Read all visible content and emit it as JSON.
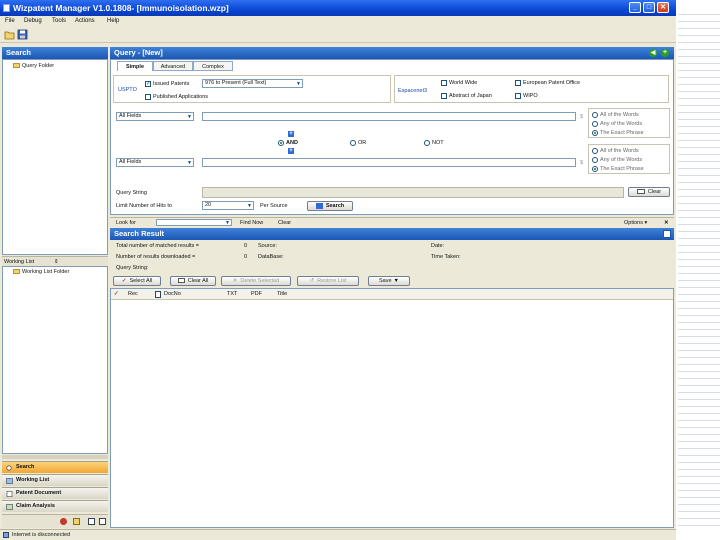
{
  "window": {
    "title": "Wizpatent Manager V1.0.1808- [Immunoisolation.wzp]",
    "minimize_glyph": "_",
    "maximize_glyph": "□",
    "close_glyph": "✕"
  },
  "menu": [
    "File",
    "Debug",
    "Tools",
    "Actions",
    "Help"
  ],
  "left_panel": {
    "search_header": "Search",
    "query_folder": "Query Folder",
    "working_list_header": "Working List",
    "working_list_pin": "⇕",
    "working_list_folder": "Working List Folder",
    "nav": [
      "Search",
      "Working List",
      "Patent Document",
      "Claim Analysis"
    ]
  },
  "query": {
    "header": "Query - [New]",
    "tabs": [
      "Simple",
      "Advanced",
      "Complex"
    ],
    "uspto_label": "USPTO",
    "issued_patents": "Issued Patents",
    "issued_range": "976 to Present (Full Text)",
    "published_apps": "Published Applications",
    "espacenet_label": "Espacenet3",
    "world_wide": "World Wide",
    "european_patent_office": "European Patent Office",
    "abstract_of_japan": "Abstract of Japan",
    "wipo": "WIPO",
    "field1": "All Fields",
    "field2": "All Fields",
    "match_options": [
      "All of the Words",
      "Any of the Words",
      "The Exact Phrase"
    ],
    "operators": [
      "AND",
      "OR",
      "NOT"
    ],
    "query_string_label": "Query String",
    "clear_label": "Clear",
    "limit_label": "Limit Number of Hits to",
    "limit_value": "20",
    "per_source": "Per Source",
    "search_label": "Search",
    "plus_glyph": "+"
  },
  "find_bar": {
    "look_for": "Look for",
    "find_now": "Find Now",
    "clear": "Clear",
    "options": "Options"
  },
  "results": {
    "header": "Search Result",
    "total_label": "Total number of matched results =",
    "total_value": "0",
    "downloaded_label": "Number of results downloaded =",
    "downloaded_value": "0",
    "source_label": "Source:",
    "database_label": "DataBase:",
    "date_label": "Date:",
    "time_taken_label": "Time Taken:",
    "query_string_label": "Query String:",
    "buttons": [
      "Select All",
      "Clear All",
      "Delete Selected",
      "Restore List",
      "Save"
    ],
    "columns": [
      "Rec",
      "DocNo",
      "TXT",
      "PDF",
      "Title"
    ]
  },
  "status": {
    "text": "Internet is disconnected"
  },
  "colors": {
    "title_blue": "#0a47d6",
    "panel_header": "#1b56b5",
    "nav_active": "#f3a732",
    "window_bg": "#ece9d8"
  }
}
